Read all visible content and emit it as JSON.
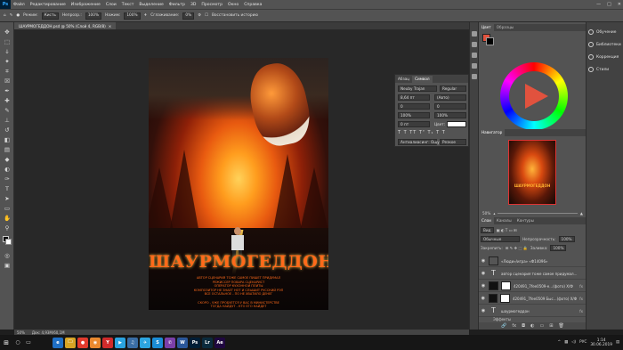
{
  "app": {
    "logo": "Ps"
  },
  "menu": [
    "Файл",
    "Редактирование",
    "Изображение",
    "Слои",
    "Текст",
    "Выделение",
    "Фильтр",
    "3D",
    "Просмотр",
    "Окно",
    "Справка"
  ],
  "window_controls": {
    "minimize": "—",
    "maximize": "□",
    "close": "✕"
  },
  "options": {
    "mode_label": "Режим:",
    "mode_value": "Кисть",
    "opacity_label": "Непрозр.:",
    "opacity_value": "100%",
    "flow_label": "Нажим:",
    "flow_value": "100%",
    "smoothing_label": "Сглаживание:",
    "smoothing_value": "0%",
    "sample_all": "Восстановить историю"
  },
  "document_tab": {
    "title": "ШАУРМОГЕДДОН.psd @ 50% (Слой 4, RGB/8)",
    "close": "×"
  },
  "poster": {
    "title": "ШАУРМОГЕДДОН",
    "credits": [
      "Автор сценария тоже самое пишет придумал",
      "режиссер повара сценарист",
      "оператор кухонной плиты",
      "композитор не знает нот и слышит русский рэп",
      "все остальное - по не хватило денег",
      "",
      "Скоро - Уже пробуется у Вас в министерстве",
      "тогда найдут - кто его найдет"
    ]
  },
  "character_panel": {
    "tabs": [
      "Абзац",
      "Символ"
    ],
    "font_family": "Neuby Trajan",
    "font_style": "Regular",
    "size": "8,64 пт",
    "leading": "(Авто)",
    "tracking_left": "0",
    "tracking_right": "0",
    "scale_v": "100%",
    "scale_h": "100%",
    "baseline": "0 пт",
    "color_label": "Цвет:",
    "antialias": "Антиалиасинг: Ощущ.",
    "lang": "Резкое"
  },
  "color_panel": {
    "tabs": [
      "Цвет",
      "Образцы"
    ],
    "swatch_fg": "#e1523e"
  },
  "navigator": {
    "tab": "Навигатор",
    "zoom": "50%",
    "thumb_title": "ШАУРМОГЕДДОН"
  },
  "layers_panel": {
    "tabs": [
      "Слои",
      "Каналы",
      "Контуры"
    ],
    "filter": "Вид",
    "blend": "Обычные",
    "opacity_label": "Непрозрачность:",
    "opacity_value": "100%",
    "lock_label": "Закрепить:",
    "fill_label": "Заливка:",
    "fill_value": "100%",
    "layers": [
      {
        "name": "«Люди»/игра» «Ф14096»",
        "kind": "smart",
        "fx": ""
      },
      {
        "name": "автор сценария тоже самое придумал…",
        "kind": "text",
        "fx": ""
      },
      {
        "name": "420491_7fee0509-e…(фото) Х/Ф",
        "kind": "image",
        "fx": "fx"
      },
      {
        "name": "420491_7fee0509 Быс…(фото) Х/Ф",
        "kind": "image",
        "fx": "fx"
      },
      {
        "name": "шаурмогеддон",
        "kind": "text",
        "fx": "fx"
      }
    ],
    "effects_label": "Эффекты",
    "bottom_icons": [
      "🔗",
      "fx",
      "◘",
      "◐",
      "▭",
      "⊞",
      "🗑"
    ]
  },
  "side_panels": {
    "items": [
      "Обучение",
      "Библиотеки",
      "Коррекция",
      "Стили"
    ]
  },
  "status": {
    "zoom": "50%",
    "doc": "Док: 4,93М/60,1М"
  },
  "taskbar": {
    "apps": [
      {
        "label": "e",
        "color": "#1f6fc5"
      },
      {
        "label": "🗀",
        "color": "#d7a425"
      },
      {
        "label": "●",
        "color": "#e23b2e"
      },
      {
        "label": "◉",
        "color": "#e9892f"
      },
      {
        "label": "Y",
        "color": "#d12b2b"
      },
      {
        "label": "▶",
        "color": "#2aa3e0"
      },
      {
        "label": "♫",
        "color": "#3a6ea5"
      },
      {
        "label": "✈",
        "color": "#2ca5e0"
      },
      {
        "label": "S",
        "color": "#1b8dd6"
      },
      {
        "label": "✆",
        "color": "#7b3fa8"
      },
      {
        "label": "W",
        "color": "#2b579a"
      },
      {
        "label": "Ps",
        "color": "#001e36"
      },
      {
        "label": "Lr",
        "color": "#0b2b3d"
      },
      {
        "label": "Ae",
        "color": "#1f0740"
      }
    ],
    "lang": "РУС",
    "time": "1:14",
    "date": "30.06.2019"
  }
}
